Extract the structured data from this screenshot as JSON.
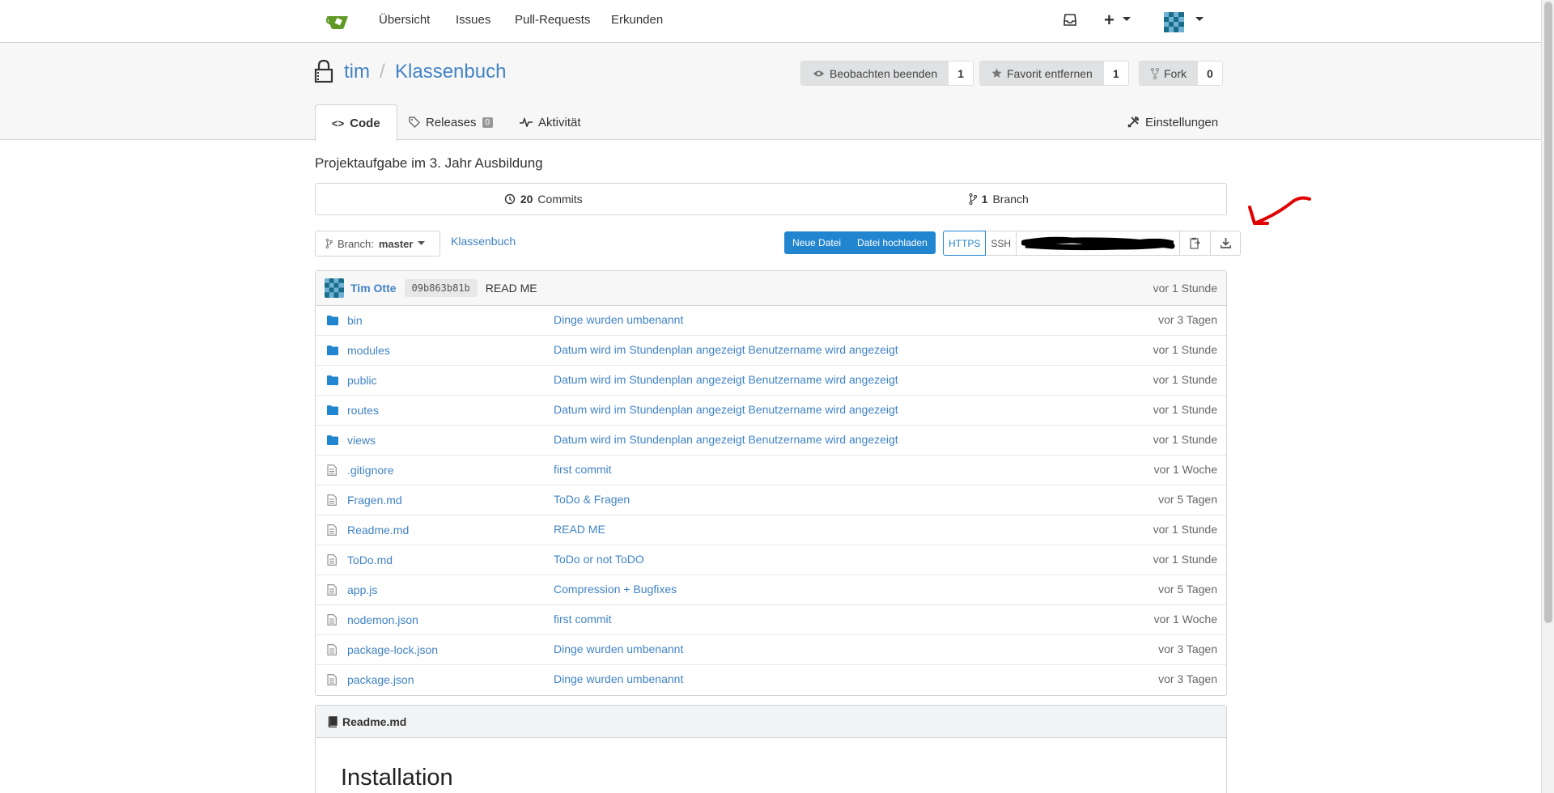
{
  "nav": {
    "items": [
      "Übersicht",
      "Issues",
      "Pull-Requests",
      "Erkunden"
    ],
    "plus_label": "+"
  },
  "repo": {
    "owner": "tim",
    "separator": "/",
    "name": "Klassenbuch",
    "watch_label": "Beobachten beenden",
    "watch_count": "1",
    "star_label": "Favorit entfernen",
    "star_count": "1",
    "fork_label": "Fork",
    "fork_count": "0"
  },
  "tabs": {
    "code": "Code",
    "releases": "Releases",
    "releases_count": "0",
    "activity": "Aktivität",
    "settings": "Einstellungen"
  },
  "description": "Projektaufgabe im 3. Jahr Ausbildung",
  "stats": {
    "commits_count": "20",
    "commits_label": "Commits",
    "branch_count": "1",
    "branch_label": "Branch"
  },
  "toolbar": {
    "branch_prefix": "Branch:",
    "branch_name": "master",
    "breadcrumb": "Klassenbuch",
    "new_file": "Neue Datei",
    "upload_file": "Datei hochladen",
    "https": "HTTPS",
    "ssh": "SSH"
  },
  "latest_commit": {
    "author": "Tim Otte",
    "sha": "09b863b81b",
    "message": "READ ME",
    "time": "vor 1 Stunde"
  },
  "files": [
    {
      "name": "bin",
      "type": "folder",
      "message": "Dinge wurden umbenannt",
      "age": "vor 3 Tagen"
    },
    {
      "name": "modules",
      "type": "folder",
      "message": "Datum wird im Stundenplan angezeigt Benutzername wird angezeigt",
      "age": "vor 1 Stunde"
    },
    {
      "name": "public",
      "type": "folder",
      "message": "Datum wird im Stundenplan angezeigt Benutzername wird angezeigt",
      "age": "vor 1 Stunde"
    },
    {
      "name": "routes",
      "type": "folder",
      "message": "Datum wird im Stundenplan angezeigt Benutzername wird angezeigt",
      "age": "vor 1 Stunde"
    },
    {
      "name": "views",
      "type": "folder",
      "message": "Datum wird im Stundenplan angezeigt Benutzername wird angezeigt",
      "age": "vor 1 Stunde"
    },
    {
      "name": ".gitignore",
      "type": "file",
      "message": "first commit",
      "age": "vor 1 Woche"
    },
    {
      "name": "Fragen.md",
      "type": "file",
      "message": "ToDo & Fragen",
      "age": "vor 5 Tagen"
    },
    {
      "name": "Readme.md",
      "type": "file",
      "message": "READ ME",
      "age": "vor 1 Stunde"
    },
    {
      "name": "ToDo.md",
      "type": "file",
      "message": "ToDo or not ToDO",
      "age": "vor 1 Stunde"
    },
    {
      "name": "app.js",
      "type": "file",
      "message": "Compression + Bugfixes",
      "age": "vor 5 Tagen"
    },
    {
      "name": "nodemon.json",
      "type": "file",
      "message": "first commit",
      "age": "vor 1 Woche"
    },
    {
      "name": "package-lock.json",
      "type": "file",
      "message": "Dinge wurden umbenannt",
      "age": "vor 3 Tagen"
    },
    {
      "name": "package.json",
      "type": "file",
      "message": "Dinge wurden umbenannt",
      "age": "vor 3 Tagen"
    }
  ],
  "readme": {
    "filename": "Readme.md",
    "heading": "Installation"
  },
  "icons": {
    "logo": "gitea-logo-icon",
    "inbox": "inbox-icon",
    "lock": "lock-icon",
    "folder": "folder-icon",
    "file": "file-icon"
  },
  "colors": {
    "link": "#4183c4",
    "primary_button": "#2185d0",
    "logo_green": "#609926",
    "annotation_red": "#e00000"
  }
}
